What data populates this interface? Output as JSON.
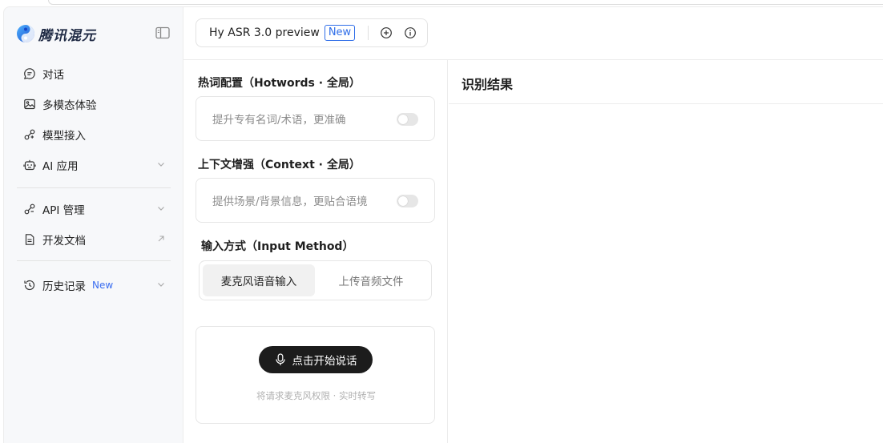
{
  "brand": {
    "name": "腾讯混元"
  },
  "sidebar": {
    "items": [
      {
        "label": "对话",
        "icon": "chat-icon"
      },
      {
        "label": "多模态体验",
        "icon": "image-icon"
      },
      {
        "label": "模型接入",
        "icon": "model-access-icon"
      },
      {
        "label": "AI 应用",
        "icon": "robot-icon"
      },
      {
        "label": "API 管理",
        "icon": "api-icon"
      },
      {
        "label": "开发文档",
        "icon": "document-icon"
      },
      {
        "label": "历史记录",
        "icon": "history-icon",
        "badge": "New"
      }
    ]
  },
  "model_bar": {
    "model_name": "Hy ASR 3.0 preview",
    "badge": "New"
  },
  "hotwords": {
    "title": "热词配置（Hotwords · 全局）",
    "placeholder": "提升专有名词/术语，更准确",
    "enabled": false
  },
  "context": {
    "title": "上下文增强（Context · 全局）",
    "placeholder": "提供场景/背景信息，更贴合语境",
    "enabled": false
  },
  "input_method": {
    "title": "输入方式（Input Method）",
    "options": [
      "麦克风语音输入",
      "上传音频文件"
    ],
    "selected": "麦克风语音输入"
  },
  "record": {
    "button_label": "点击开始说话",
    "hint": "将请求麦克风权限 · 实时转写"
  },
  "result": {
    "title": "识别结果"
  },
  "colors": {
    "accent": "#2f6ee8",
    "record_button": "#1c1c1c"
  }
}
